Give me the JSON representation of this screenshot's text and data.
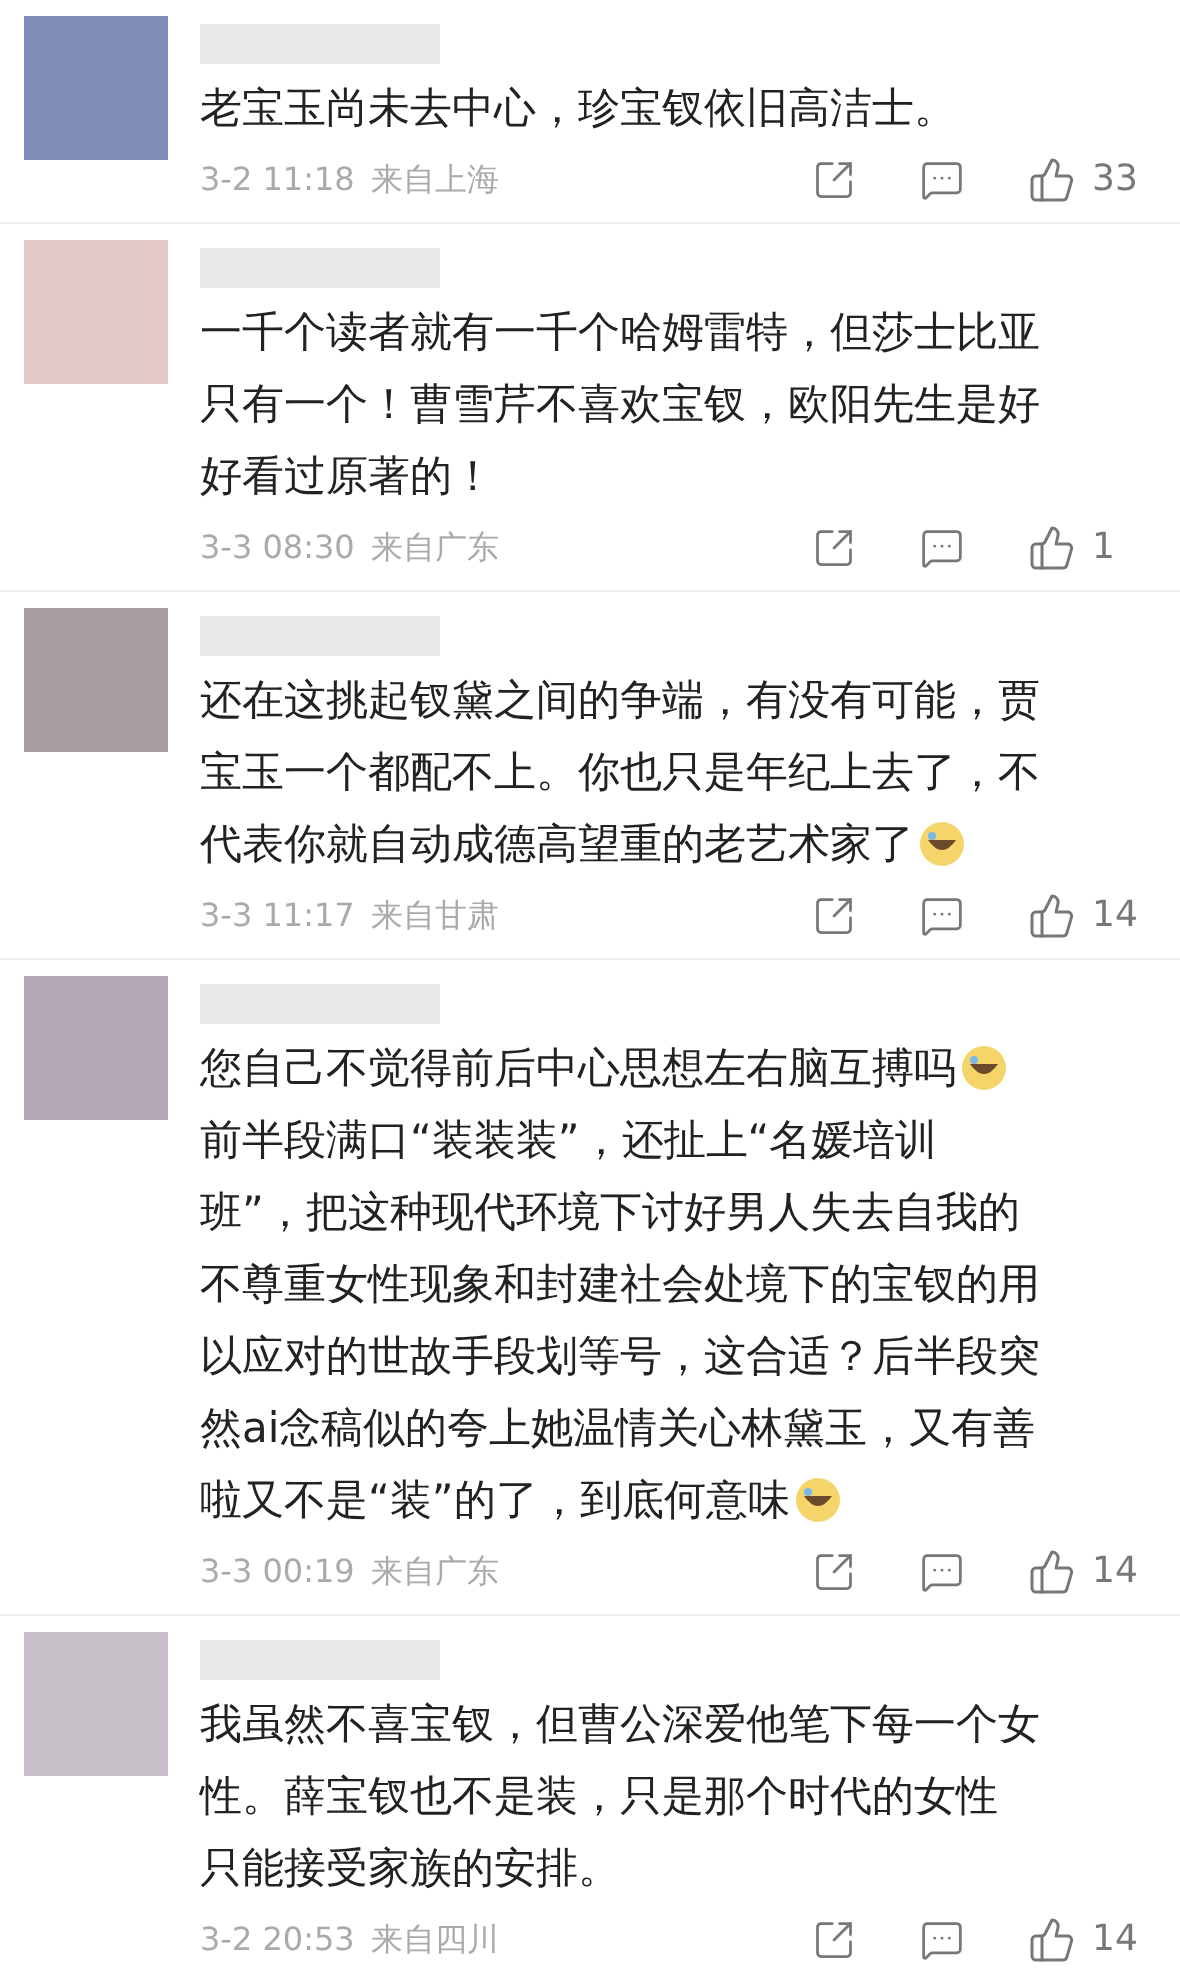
{
  "comments": [
    {
      "color": "#7f8fb8",
      "lines": [
        {
          "text": "老宝玉尚未去中心，珍宝钗依旧高洁士。",
          "emoji": false
        }
      ],
      "time": "3-2 11:18",
      "location": "来自上海",
      "likes": "33"
    },
    {
      "color": "#e3c8c8",
      "lines": [
        {
          "text": "一千个读者就有一千个哈姆雷特，但莎士比亚",
          "emoji": false
        },
        {
          "text": "只有一个！曹雪芹不喜欢宝钗，欧阳先生是好",
          "emoji": false
        },
        {
          "text": "好看过原著的！",
          "emoji": false
        }
      ],
      "time": "3-3 08:30",
      "location": "来自广东",
      "likes": "1"
    },
    {
      "color": "#a8a0a0",
      "lines": [
        {
          "text": "还在这挑起钗黛之间的争端，有没有可能，贾",
          "emoji": false
        },
        {
          "text": "宝玉一个都配不上。你也只是年纪上去了，不",
          "emoji": false
        },
        {
          "text": "代表你就自动成德高望重的老艺术家了",
          "emoji": true
        }
      ],
      "time": "3-3 11:17",
      "location": "来自甘肃",
      "likes": "14"
    },
    {
      "color": "#b4a8b4",
      "lines": [
        {
          "text": "您自己不觉得前后中心思想左右脑互搏吗",
          "emoji": true
        },
        {
          "text": "前半段满口“装装装”，还扯上“名媛培训",
          "emoji": false
        },
        {
          "text": "班”，把这种现代环境下讨好男人失去自我的",
          "emoji": false
        },
        {
          "text": "不尊重女性现象和封建社会处境下的宝钗的用",
          "emoji": false
        },
        {
          "text": "以应对的世故手段划等号，这合适？后半段突",
          "emoji": false
        },
        {
          "text": "然ai念稿似的夸上她温情关心林黛玉，又有善",
          "emoji": false
        },
        {
          "text": "啦又不是“装”的了，到底何意味",
          "emoji": true
        }
      ],
      "time": "3-3 00:19",
      "location": "来自广东",
      "likes": "14"
    },
    {
      "color": "#c8c0c8",
      "lines": [
        {
          "text": "我虽然不喜宝钗，但曹公深爱他笔下每一个女",
          "emoji": false
        },
        {
          "text": "性。薛宝钗也不是装，只是那个时代的女性",
          "emoji": false
        },
        {
          "text": "只能接受家族的安排。",
          "emoji": false
        }
      ],
      "time": "3-2 20:53",
      "location": "来自四川",
      "likes": "14"
    }
  ]
}
